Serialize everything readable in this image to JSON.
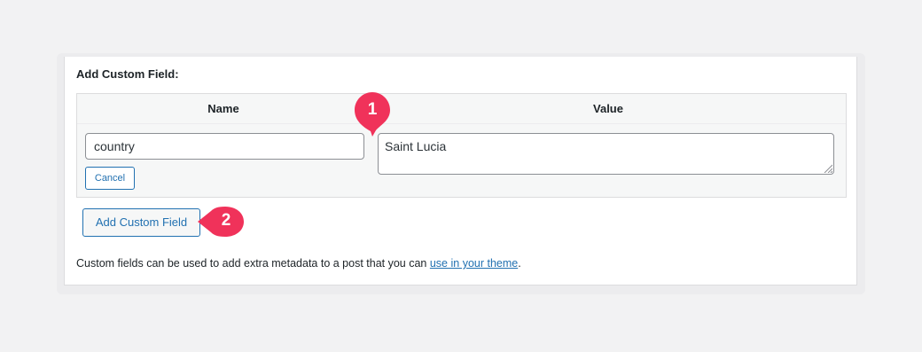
{
  "panel": {
    "title": "Add Custom Field:"
  },
  "table": {
    "headers": {
      "name": "Name",
      "value": "Value"
    },
    "name_value": "country",
    "value_value": "Saint Lucia",
    "cancel_label": "Cancel"
  },
  "add_button_label": "Add Custom Field",
  "help": {
    "text": "Custom fields can be used to add extra metadata to a post that you can ",
    "link": "use in your theme",
    "suffix": "."
  },
  "markers": [
    {
      "number": "1"
    },
    {
      "number": "2"
    }
  ],
  "colors": {
    "accent": "#2271b1",
    "marker": "#f0325a",
    "page_bg": "#f2f2f3"
  }
}
